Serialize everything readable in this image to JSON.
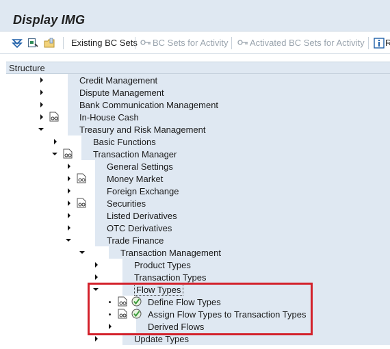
{
  "window": {
    "title": "Display IMG"
  },
  "toolbar": {
    "existing_bc_sets": "Existing BC Sets",
    "bc_sets_for_activity": "BC Sets for Activity",
    "activated_bc_sets": "Activated BC Sets for Activity",
    "cut_off_label": "R"
  },
  "tree": {
    "header": "Structure",
    "items": [
      {
        "label": "Credit Management"
      },
      {
        "label": "Dispute Management"
      },
      {
        "label": "Bank Communication Management"
      },
      {
        "label": "In-House Cash"
      },
      {
        "label": "Treasury and Risk Management"
      },
      {
        "label": "Basic Functions"
      },
      {
        "label": "Transaction Manager"
      },
      {
        "label": "General Settings"
      },
      {
        "label": "Money Market"
      },
      {
        "label": "Foreign Exchange"
      },
      {
        "label": "Securities"
      },
      {
        "label": "Listed Derivatives"
      },
      {
        "label": "OTC Derivatives"
      },
      {
        "label": "Trade Finance"
      },
      {
        "label": "Transaction Management"
      },
      {
        "label": "Product Types"
      },
      {
        "label": "Transaction Types"
      },
      {
        "label": "Flow Types"
      },
      {
        "label": "Define Flow Types"
      },
      {
        "label": "Assign Flow Types to Transaction Types"
      },
      {
        "label": "Derived Flows"
      },
      {
        "label": "Update Types"
      }
    ]
  },
  "colors": {
    "band": "#dfe8f2",
    "highlight": "#d3202a",
    "check": "#3a9b3a"
  }
}
